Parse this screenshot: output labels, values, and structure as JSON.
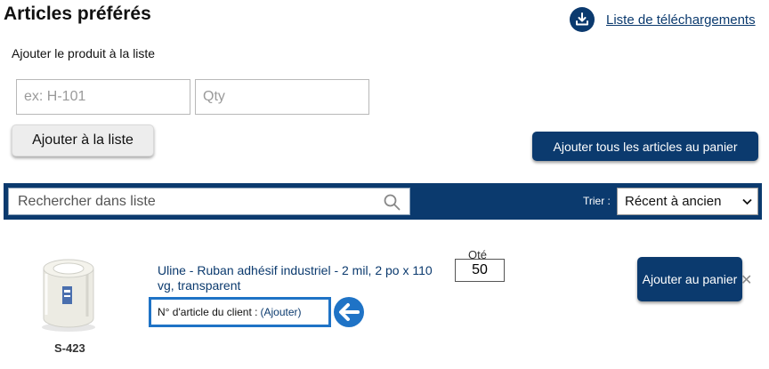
{
  "page": {
    "title": "Articles préférés",
    "download_link": "Liste de téléchargements"
  },
  "add_form": {
    "label": "Ajouter le produit à la liste",
    "sku_placeholder": "ex: H-101",
    "qty_placeholder": "Qty",
    "add_button": "Ajouter à la liste"
  },
  "add_all_button": "Ajouter tous les articles au panier",
  "search": {
    "placeholder": "Rechercher dans liste",
    "sort_label": "Trier :",
    "sort_value": "Récent à ancien"
  },
  "items": [
    {
      "sku": "S-423",
      "title": "Uline - Ruban adhésif industriel - 2 mil, 2 po x 110 vg, transparent",
      "customer_number_label": "N° d'article du client :",
      "customer_number_link": "(Ajouter)",
      "qty_label": "Qté",
      "qty_value": "50",
      "add_to_cart": "Ajouter au panier",
      "remove_symbol": "✕"
    }
  ],
  "colors": {
    "brand_navy": "#0b3a6e",
    "highlight_blue": "#1f73c6"
  }
}
